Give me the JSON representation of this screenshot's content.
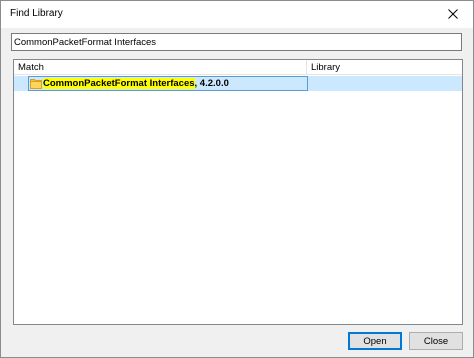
{
  "window": {
    "title": "Find Library",
    "close_icon": "close-x-icon"
  },
  "search": {
    "value": "CommonPacketFormat Interfaces",
    "placeholder": ""
  },
  "results": {
    "columns": [
      "Match",
      "Library"
    ],
    "rows": [
      {
        "icon": "folder-icon",
        "match_highlight": "CommonPacketFormat Interfaces",
        "match_suffix": ", 4.2.0.0",
        "library": "",
        "selected": true
      }
    ]
  },
  "buttons": {
    "open_label": "Open",
    "close_label": "Close"
  },
  "colors": {
    "selection_bg": "#cce8ff",
    "selection_border": "#5b9bd5",
    "highlight": "#ffff00",
    "folder": "#f6c342",
    "default_button_border": "#0078d7"
  }
}
